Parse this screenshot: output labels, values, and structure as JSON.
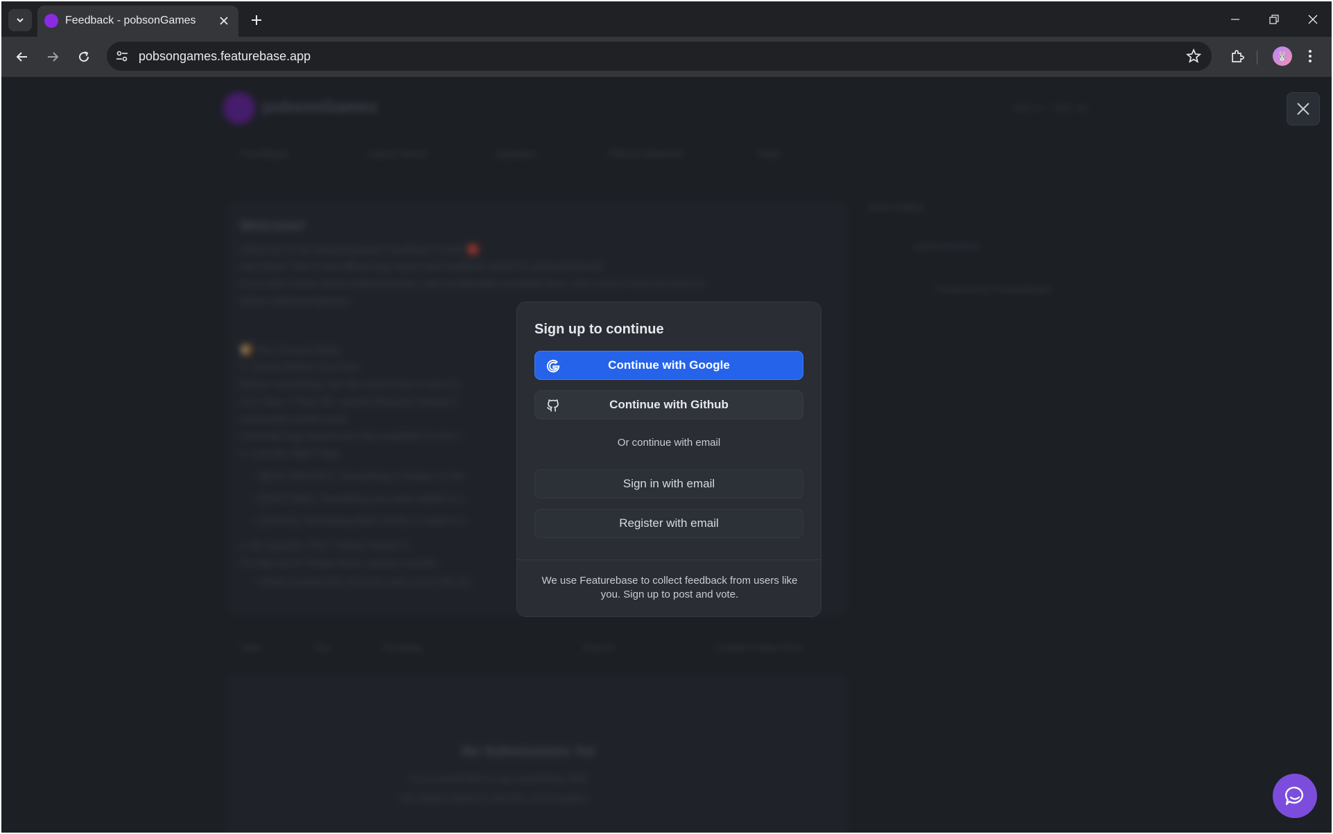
{
  "browser": {
    "tab_title": "Feedback - pobsonGames",
    "url": "pobsongames.featurebase.app",
    "avatar_emoji": "🐰"
  },
  "background_page": {
    "brand": "pobsonGames",
    "sign_in_link": "Sign in / Sign up",
    "nav": [
      "Feedback",
      "Latest News",
      "Updates",
      "Official Website",
      "Help"
    ],
    "welcome_title": "Welcome!",
    "welcome_lines": [
      "Welcome to the pobsonGames Feedback Portal! 🔴",
      "Hey there! This is the official bug report and feedback portal for pobsonGames!",
      "If you don't know about pobsonGames, and accidentally stumbled here, don't worry! Find out more at",
      "admin.at/pobsongames!"
    ],
    "rules_lines": [
      "🍞 The Ground Rules",
      "1. Check Before You Post",
      "Before submitting, use the search bar to see if s",
      "your idea. If they did, upvote that post instead o",
      "community wants most.",
      "Currently bug reports are only available for the c",
      "2. Use the Right Tags",
      "• [BUG REPORT]: Something is broken or the",
      "• [FEATURE]: Something you want added to y",
      "• [ISSUE]: Something feels clunky or hard to u",
      "3. Be Specific (The \"Hobby Pattern\")",
      "To help me fix things faster, please include:",
      "• What browser/OS (Chrome and Linux) the tim"
    ],
    "side_title": "Most helpful",
    "side_item": "pobsonGames",
    "powered": "Powered by Featurebase",
    "filters": [
      "New",
      "Top",
      "Trending"
    ],
    "search_label": "Search",
    "create_post": "Create A New Post",
    "empty_title": "No Submissions Yet",
    "empty_lines": [
      "If you would like to say something click",
      "the button below to join the conversation."
    ]
  },
  "modal": {
    "title": "Sign up to continue",
    "google_label": "Continue with Google",
    "github_label": "Continue with Github",
    "or_text": "Or continue with email",
    "signin_label": "Sign in with email",
    "register_label": "Register with email",
    "footer": "We use Featurebase to collect feedback from users like you. Sign up to post and vote."
  },
  "colors": {
    "google_button": "#2563eb",
    "chat_bubble": "#7c4ddc",
    "brand_purple": "#8a2be2"
  },
  "icons": [
    "chevron-down-icon",
    "close-icon",
    "plus-icon",
    "back-icon",
    "forward-icon",
    "reload-icon",
    "site-settings-icon",
    "star-icon",
    "extensions-icon",
    "kebab-icon",
    "google-icon",
    "github-icon",
    "chat-icon"
  ]
}
